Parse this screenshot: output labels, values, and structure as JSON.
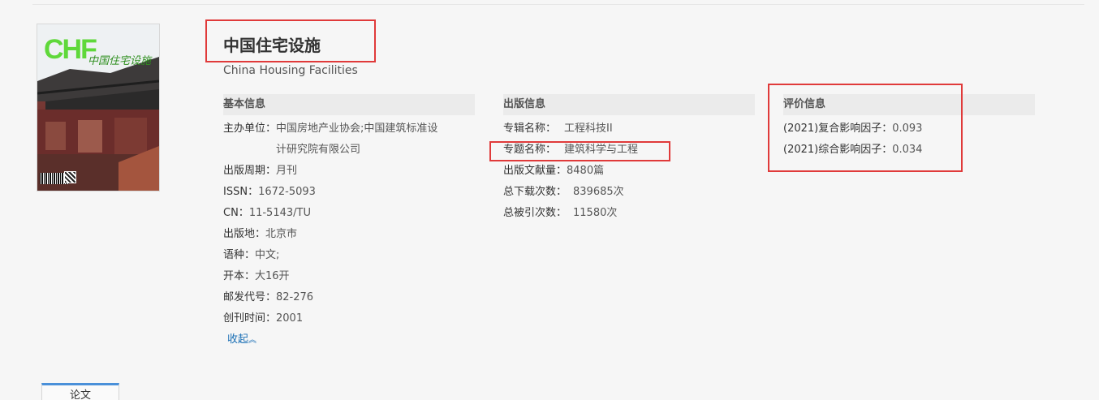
{
  "journal": {
    "title_cn": "中国住宅设施",
    "title_en": "China Housing Facilities",
    "cover_logo": "CHF",
    "cover_script": "中国住宅设施"
  },
  "basic_info": {
    "header": "基本信息",
    "rows": [
      {
        "key": "主办单位：",
        "value": "中国房地产业协会;中国建筑标准设计研究院有限公司"
      },
      {
        "key": "出版周期：",
        "value": "月刊"
      },
      {
        "key": "ISSN：",
        "value": "1672-5093"
      },
      {
        "key": "CN：",
        "value": "11-5143/TU"
      },
      {
        "key": "出版地：",
        "value": "北京市"
      },
      {
        "key": "语种：",
        "value": "中文;"
      },
      {
        "key": "开本：",
        "value": "大16开"
      },
      {
        "key": "邮发代号：",
        "value": "82-276"
      },
      {
        "key": "创刊时间：",
        "value": "2001"
      }
    ],
    "collapse_label": "收起"
  },
  "publish_info": {
    "header": "出版信息",
    "rows": [
      {
        "key": "专辑名称：",
        "value": "工程科技II"
      },
      {
        "key": "专题名称：",
        "value": "建筑科学与工程"
      },
      {
        "key": "出版文献量：",
        "value": "8480篇"
      },
      {
        "key": "总下载次数：",
        "value": "839685次"
      },
      {
        "key": "总被引次数：",
        "value": "11580次"
      }
    ]
  },
  "eval_info": {
    "header": "评价信息",
    "rows": [
      {
        "key": "(2021)复合影响因子：",
        "value": "0.093"
      },
      {
        "key": "(2021)综合影响因子：",
        "value": "0.034"
      }
    ]
  },
  "bottom_tab": {
    "label": "论文"
  },
  "colors": {
    "highlight": "#e03a3a",
    "link": "#1a6fb5",
    "tab_accent": "#4a90d9"
  }
}
